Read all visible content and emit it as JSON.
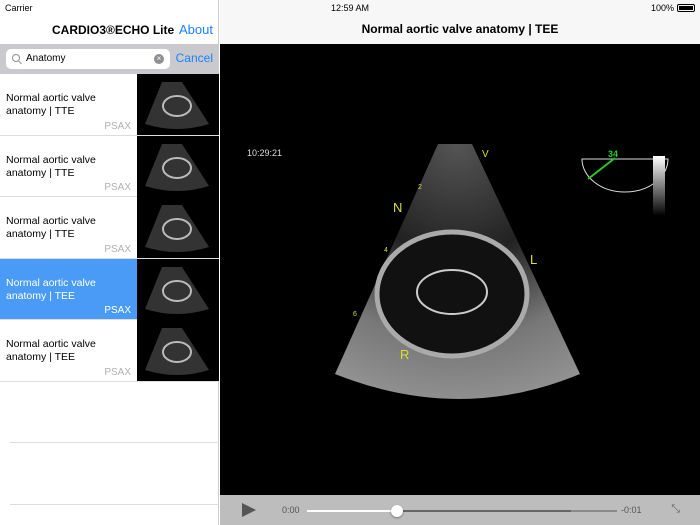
{
  "status": {
    "carrier": "Carrier",
    "time": "12:59 AM",
    "battery": "100%"
  },
  "sidebar": {
    "title": "CARDIO3®ECHO Lite",
    "about": "About",
    "search": {
      "value": "Anatomy",
      "cancel": "Cancel"
    },
    "items": [
      {
        "title": "Normal aortic valve anatomy | TTE",
        "tag": "PSAX",
        "selected": false
      },
      {
        "title": "Normal aortic valve anatomy | TTE",
        "tag": "PSAX",
        "selected": false
      },
      {
        "title": "Normal aortic valve anatomy | TTE",
        "tag": "PSAX",
        "selected": false
      },
      {
        "title": "Normal aortic valve anatomy | TEE",
        "tag": "PSAX",
        "selected": true
      },
      {
        "title": "Normal aortic valve anatomy | TEE",
        "tag": "PSAX",
        "selected": false
      }
    ]
  },
  "detail": {
    "title": "Normal aortic valve anatomy | TEE",
    "echo": {
      "timestamp": "10:29:21",
      "angle": "34",
      "labels": {
        "n": "N",
        "l": "L",
        "r": "R",
        "v": "V",
        "d2": "2",
        "d4": "4",
        "d6": "6"
      }
    },
    "player": {
      "elapsed": "0:00",
      "remaining": "-0:01",
      "progress": 0.29,
      "buffered": 0.85
    }
  }
}
